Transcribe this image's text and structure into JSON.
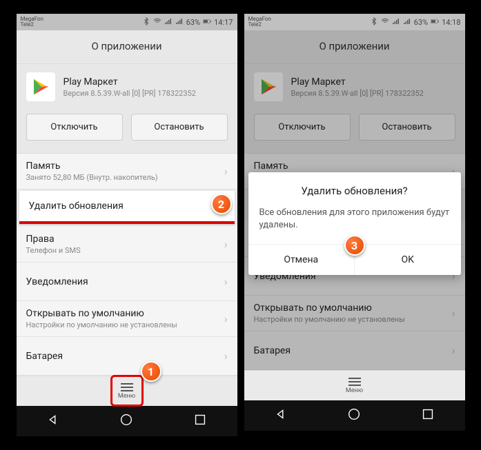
{
  "status": {
    "carrier1": "MegaFon",
    "carrier2": "Tele2",
    "battery": "63%",
    "time": "14:17",
    "time2": "14:18"
  },
  "header": {
    "title": "О приложении"
  },
  "app": {
    "name": "Play Маркет",
    "version": "Версия 8.5.39.W-all [0] [PR] 178322352"
  },
  "buttons": {
    "disable": "Отключить",
    "stop": "Остановить"
  },
  "rows": {
    "memory_title": "Память",
    "memory_sub": "Занято 52,80 МБ (Внутр. накопитель)",
    "delete_updates": "Удалить обновления",
    "rights_title": "Права",
    "rights_sub": "Телефон и SMS",
    "notifications": "Уведомления",
    "open_default_title": "Открывать по умолчанию",
    "open_default_sub": "Настройки по умолчанию не установлены",
    "battery": "Батарея"
  },
  "menu": {
    "label": "Меню"
  },
  "dialog": {
    "title": "Удалить обновления?",
    "message": "Все обновления для этого приложения будут удалены.",
    "cancel": "Отмена",
    "ok": "OK"
  },
  "badges": {
    "b1": "1",
    "b2": "2",
    "b3": "3"
  }
}
